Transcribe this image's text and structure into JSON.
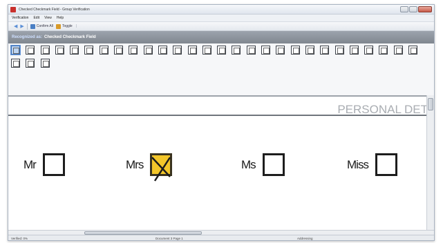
{
  "window": {
    "title": "Checked Checkmark Field - Group Verification"
  },
  "menu": {
    "items": [
      "Verification",
      "Edit",
      "View",
      "Help"
    ]
  },
  "toolbar": {
    "confirm_label": "Confirm All",
    "toggle_label": "Toggle",
    "disabled_label": " |"
  },
  "recognition": {
    "label": "Recognized as:",
    "value": "Checked Checkmark Field"
  },
  "thumbnails": {
    "count": 31,
    "selected_index": 0
  },
  "document": {
    "heading": "PERSONAL DET",
    "salutations": [
      {
        "label": "Mr",
        "checked": false
      },
      {
        "label": "Mrs",
        "checked": true
      },
      {
        "label": "Ms",
        "checked": false
      },
      {
        "label": "Miss",
        "checked": false
      }
    ]
  },
  "status": {
    "left": "Verified: 0%",
    "middle": "Document 3 Page 1",
    "right": "Addressing"
  },
  "colors": {
    "selected_fill": "#f3c62a",
    "recognition_band": "#8b929b",
    "heading_text": "#a9adb2"
  }
}
